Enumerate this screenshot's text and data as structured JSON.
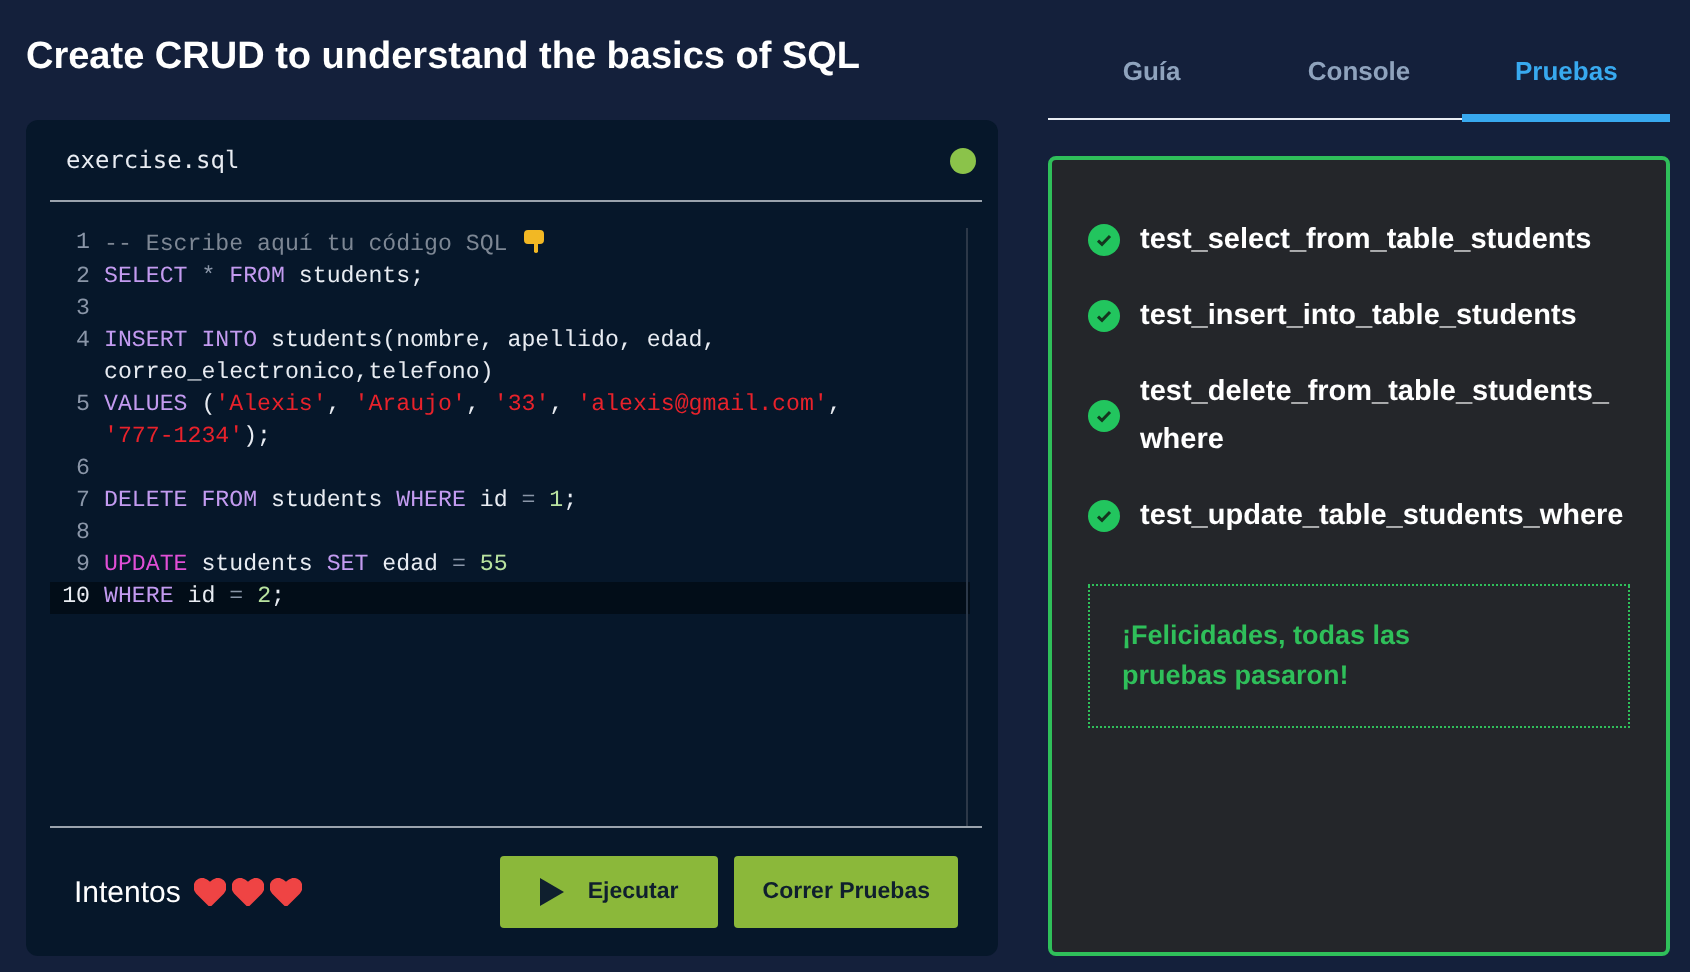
{
  "title": "Create CRUD to understand the basics of SQL",
  "editor": {
    "filename": "exercise.sql",
    "lines": [
      {
        "number": "1",
        "active": false,
        "tokens": [
          {
            "kind": "comment",
            "text": "-- Escribe aquí tu código SQL "
          },
          {
            "kind": "hand"
          }
        ]
      },
      {
        "number": "2",
        "active": false,
        "tokens": [
          {
            "kind": "keyword",
            "text": "SELECT"
          },
          {
            "kind": "operator",
            "text": " * "
          },
          {
            "kind": "keyword",
            "text": "FROM"
          },
          {
            "kind": "plain",
            "text": " students;"
          }
        ]
      },
      {
        "number": "3",
        "active": false
      },
      {
        "number": "4",
        "active": false,
        "tokens": [
          {
            "kind": "keyword",
            "text": "INSERT INTO"
          },
          {
            "kind": "plain",
            "text": " students(nombre, apellido, edad, correo_electronico,telefono)"
          }
        ]
      },
      {
        "number": "5",
        "active": false,
        "tokens": [
          {
            "kind": "keyword",
            "text": "VALUES"
          },
          {
            "kind": "plain",
            "text": " ("
          },
          {
            "kind": "string",
            "text": "'Alexis'"
          },
          {
            "kind": "plain",
            "text": ", "
          },
          {
            "kind": "string",
            "text": "'Araujo'"
          },
          {
            "kind": "plain",
            "text": ", "
          },
          {
            "kind": "string",
            "text": "'33'"
          },
          {
            "kind": "plain",
            "text": ", "
          },
          {
            "kind": "string",
            "text": "'alexis@gmail.com'"
          },
          {
            "kind": "plain",
            "text": ", "
          },
          {
            "kind": "string",
            "text": "'777-1234'"
          },
          {
            "kind": "plain",
            "text": ");"
          }
        ]
      },
      {
        "number": "6",
        "active": false
      },
      {
        "number": "7",
        "active": false,
        "tokens": [
          {
            "kind": "keyword",
            "text": "DELETE FROM"
          },
          {
            "kind": "plain",
            "text": " students "
          },
          {
            "kind": "keyword",
            "text": "WHERE"
          },
          {
            "kind": "plain",
            "text": " id "
          },
          {
            "kind": "operator",
            "text": "="
          },
          {
            "kind": "number",
            "text": " 1"
          },
          {
            "kind": "plain",
            "text": ";"
          }
        ]
      },
      {
        "number": "8",
        "active": false
      },
      {
        "number": "9",
        "active": false,
        "tokens": [
          {
            "kind": "special",
            "text": "UPDATE"
          },
          {
            "kind": "plain",
            "text": " students "
          },
          {
            "kind": "keyword",
            "text": "SET"
          },
          {
            "kind": "plain",
            "text": " edad "
          },
          {
            "kind": "operator",
            "text": "="
          },
          {
            "kind": "number",
            "text": " 55"
          }
        ]
      },
      {
        "number": "10",
        "active": true,
        "tokens": [
          {
            "kind": "keyword",
            "text": "WHERE"
          },
          {
            "kind": "plain",
            "text": " id "
          },
          {
            "kind": "operator",
            "text": "="
          },
          {
            "kind": "number",
            "text": " 2"
          },
          {
            "kind": "plain",
            "text": ";"
          }
        ]
      }
    ],
    "attempts_label": "Intentos",
    "hearts": [
      {
        "filled": true
      },
      {
        "filled": true
      },
      {
        "filled": true
      }
    ],
    "buttons": [
      {
        "label": "Ejecutar",
        "kind": "run"
      },
      {
        "label": "Correr Pruebas",
        "kind": "plain"
      }
    ]
  },
  "tabs": [
    {
      "label": "Guía",
      "selected": false
    },
    {
      "label": "Console",
      "selected": false
    },
    {
      "label": "Pruebas",
      "selected": true
    }
  ],
  "tests": [
    {
      "name": "test_select_from_table_students",
      "passed": true
    },
    {
      "name": "test_insert_into_table_students",
      "passed": true
    },
    {
      "name": "test_delete_from_table_students_where",
      "passed": true
    },
    {
      "name": "test_update_table_students_where",
      "passed": true
    }
  ],
  "result_message": "¡Felicidades, todas las pruebas pasaron!"
}
